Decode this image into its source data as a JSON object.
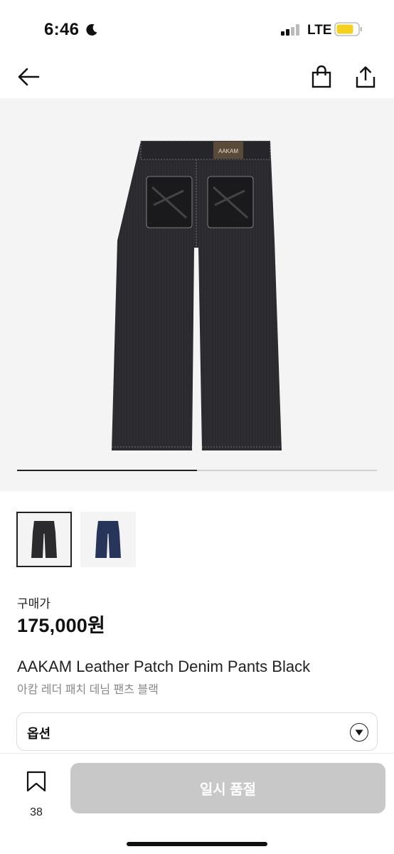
{
  "status_bar": {
    "time": "6:46",
    "network": "LTE",
    "icons": [
      "moon-icon",
      "signal-icon",
      "battery-icon"
    ],
    "battery_color": "#f5d020"
  },
  "header": {
    "icons": [
      "back-arrow-icon",
      "shopping-bag-icon",
      "share-icon"
    ]
  },
  "gallery": {
    "current_index": 1,
    "total_images": 2,
    "background_color": "#f4f4f4",
    "thumbnails": [
      {
        "name": "black-pants",
        "color": "#2b2b2e",
        "selected": true
      },
      {
        "name": "blue-pants",
        "color": "#27355a",
        "selected": false
      }
    ]
  },
  "product": {
    "price_label": "구매가",
    "price": "175,000원",
    "title": "AAKAM Leather Patch Denim Pants Black",
    "subtitle": "아캄 레더 패치 데님 팬츠 블랙"
  },
  "option": {
    "label": "옵션"
  },
  "bottom_bar": {
    "bookmark_count": "38",
    "button_label": "일시 품절",
    "button_color": "#c8c8c8"
  }
}
